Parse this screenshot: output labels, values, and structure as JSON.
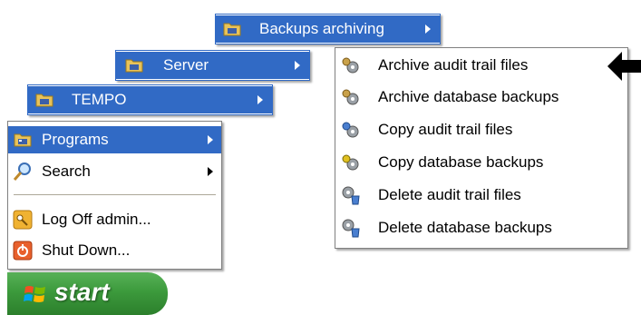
{
  "menus": {
    "backups_archiving": {
      "label": "Backups archiving",
      "highlighted": true
    },
    "server": {
      "label": "Server",
      "highlighted": true
    },
    "tempo": {
      "label": "TEMPO",
      "highlighted": true
    },
    "start_menu": {
      "items": [
        {
          "label": "Programs",
          "icon": "programs-folder-icon",
          "has_submenu": true,
          "highlighted": true
        },
        {
          "label": "Search",
          "icon": "search-magnifier-icon",
          "has_submenu": true,
          "highlighted": false
        },
        {
          "label": "Log Off admin...",
          "icon": "log-off-key-icon",
          "has_submenu": false,
          "highlighted": false
        },
        {
          "label": "Shut Down...",
          "icon": "shut-down-power-icon",
          "has_submenu": false,
          "highlighted": false
        }
      ]
    },
    "archiving_submenu": {
      "items": [
        {
          "label": "Archive audit trail files",
          "icon": "archive-gear-icon"
        },
        {
          "label": "Archive database backups",
          "icon": "archive-gear-icon"
        },
        {
          "label": "Copy audit trail files",
          "icon": "copy-gear-icon"
        },
        {
          "label": "Copy database backups",
          "icon": "copy-gear-icon"
        },
        {
          "label": "Delete audit trail files",
          "icon": "delete-gear-icon"
        },
        {
          "label": "Delete database backups",
          "icon": "delete-gear-icon"
        }
      ]
    }
  },
  "start_button": {
    "label": "start",
    "icon": "windows-flag-icon"
  },
  "pointer": {
    "icon": "black-arrow-pointer-icon"
  },
  "colors": {
    "highlight": "#316ac5",
    "start_green": "#3c9a3c",
    "folder_yellow": "#e8c35a",
    "menu_border": "#808080"
  }
}
